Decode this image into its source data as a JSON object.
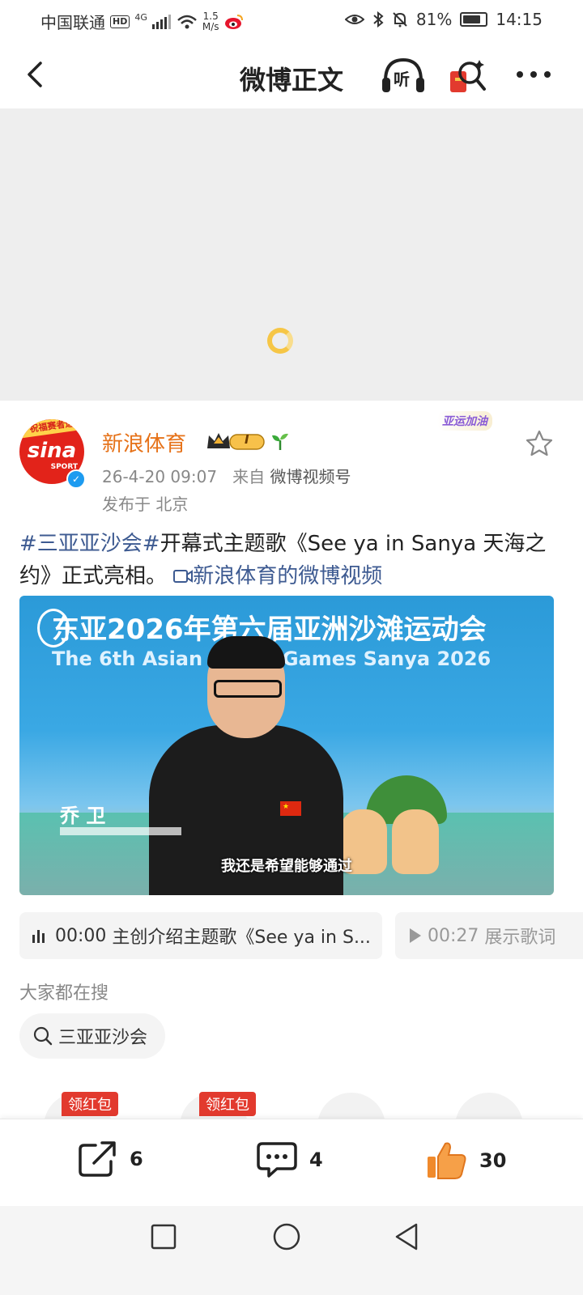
{
  "status_bar": {
    "carrier": "中国联通",
    "hd": "HD",
    "network": "4G",
    "speed_value": "1.5",
    "speed_unit": "M/s",
    "battery": "81%",
    "time": "14:15"
  },
  "header": {
    "title": "微博正文",
    "listen_label": "听"
  },
  "post": {
    "avatar_top_text": "祝福赛者运",
    "avatar_logo": "sina",
    "avatar_sport": "SPORT",
    "username": "新浪体育",
    "badge_label": "I",
    "event_tag": "亚运加油",
    "date": "26-4-20 09:07",
    "from_label": "来自",
    "source": "微博视频号",
    "location": "发布于 北京",
    "hashtag": "#三亚亚沙会#",
    "text": "开幕式主题歌《See ya in Sanya 天海之约》正式亮相。",
    "video_link": "新浪体育的微博视频"
  },
  "video": {
    "title_cn": "东亚2026年第六届亚洲沙滩运动会",
    "title_en": "The 6th Asian Beach Games Sanya 2026",
    "name": "乔 卫",
    "subtitle": "我还是希望能够通过"
  },
  "chapters": [
    {
      "time": "00:00",
      "label": "主创介绍主题歌《See ya in S..."
    },
    {
      "time": "00:27",
      "label": "展示歌词"
    }
  ],
  "search": {
    "heading": "大家都在搜",
    "chip": "三亚亚沙会"
  },
  "share_row": {
    "label1": "领红包",
    "label2": "领红包"
  },
  "actions": {
    "share_count": "6",
    "comment_count": "4",
    "like_count": "30"
  },
  "colors": {
    "brand_orange": "#e67219",
    "link_blue": "#3d5a91",
    "like_orange": "#f08a2c"
  }
}
